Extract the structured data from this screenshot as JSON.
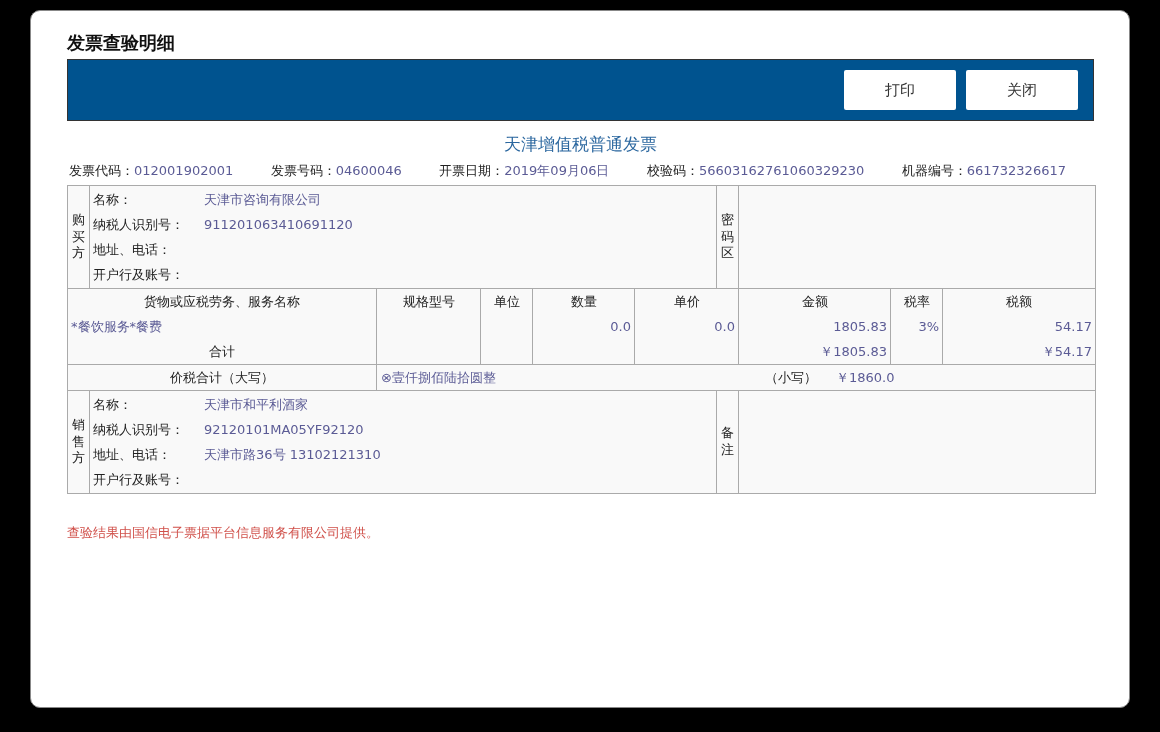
{
  "page_title": "发票查验明细",
  "toolbar": {
    "buttons": [
      "打印",
      "关闭"
    ]
  },
  "invoice": {
    "title": "天津增值税普通发票",
    "meta": [
      {
        "label": "发票代码：",
        "value": "012001902001"
      },
      {
        "label": "发票号码：",
        "value": "04600046"
      },
      {
        "label": "开票日期：",
        "value": "2019年09月06日"
      },
      {
        "label": "校验码：",
        "value": "56603162761060329230"
      },
      {
        "label": "机器编号：",
        "value": "661732326617"
      }
    ],
    "buyer": {
      "side_label": "购买方",
      "zone_label": "密码区",
      "fields": [
        {
          "label": "名称：",
          "value": "天津市咨询有限公司"
        },
        {
          "label": "纳税人识别号：",
          "value": "911201063410691120"
        },
        {
          "label": "地址、电话："
        },
        {
          "label": "开户行及账号："
        }
      ]
    },
    "items": {
      "columns": [
        "货物或应税劳务、服务名称",
        "规格型号",
        "单位",
        "数量",
        "单价",
        "金额",
        "税率",
        "税额"
      ],
      "rows": [
        {
          "name": "*餐饮服务*餐费",
          "quantity": "0.0",
          "unit_price": "0.0",
          "amount": "1805.83",
          "tax_rate": "3%",
          "tax": "54.17"
        }
      ],
      "total": {
        "label": "合计",
        "amount": "￥1805.83",
        "tax": "￥54.17"
      }
    },
    "grand_total": {
      "label": "价税合计（大写）",
      "in_words": "⊗壹仟捌佰陆拾圆整",
      "small_label": "（小写）",
      "amount": "￥1860.0"
    },
    "seller": {
      "side_label": "销售方",
      "zone_label": "备注",
      "fields": [
        {
          "label": "名称：",
          "value": "天津市和平利酒家"
        },
        {
          "label": "纳税人识别号：",
          "value": "92120101MA05YF92120"
        },
        {
          "label": "地址、电话：",
          "value": "天津市路36号 13102121310"
        },
        {
          "label": "开户行及账号："
        }
      ]
    }
  },
  "footer_note": "查验结果由国信电子票据平台信息服务有限公司提供。"
}
